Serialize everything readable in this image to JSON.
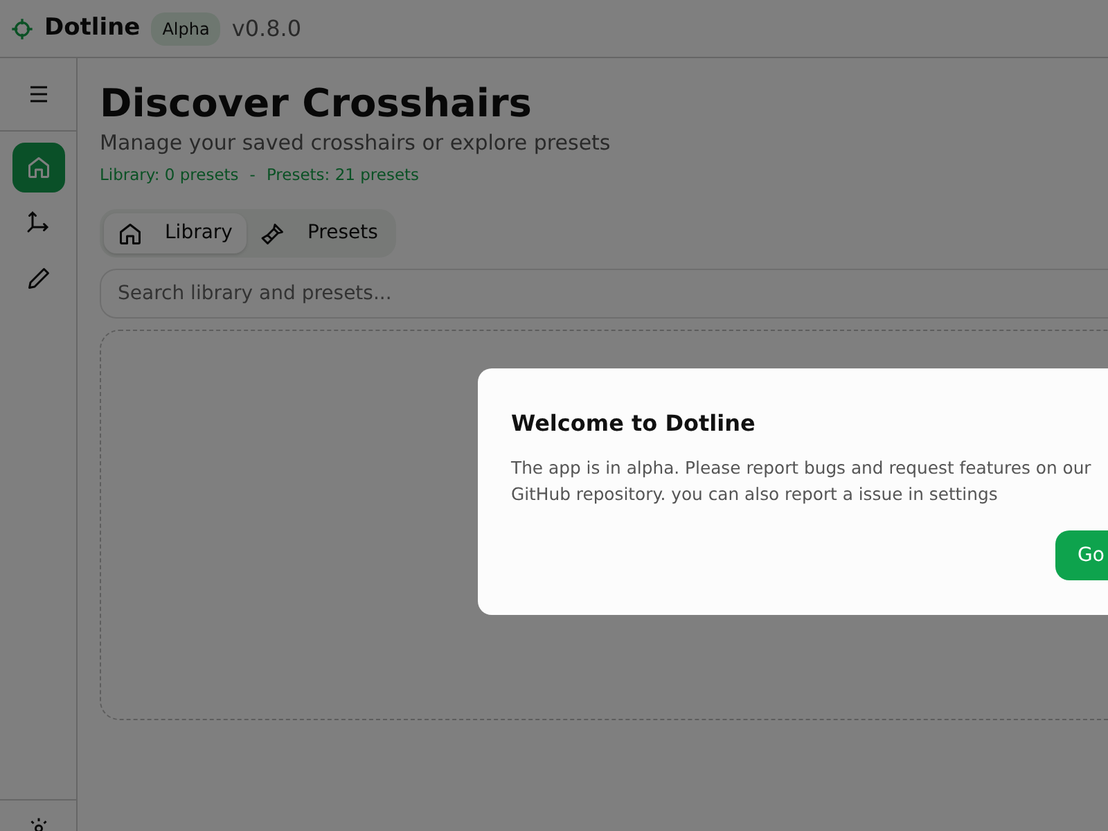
{
  "app": {
    "name": "Dotline",
    "badge": "Alpha",
    "version": "v0.8.0"
  },
  "sidebar": {
    "items": [
      {
        "kind": "home",
        "selected": true
      },
      {
        "kind": "axes",
        "selected": false
      },
      {
        "kind": "pencil",
        "selected": false
      }
    ]
  },
  "page": {
    "title": "Discover Crosshairs",
    "subtitle": "Manage your saved crosshairs or explore presets",
    "stats": [
      "Library: 0 presets",
      "-",
      "Presets: 21 presets"
    ]
  },
  "tabs": [
    {
      "label": "Library",
      "kind": "home",
      "selected": true
    },
    {
      "label": "Presets",
      "kind": "brush",
      "selected": false
    }
  ],
  "search": {
    "placeholder": "Search library and presets..."
  },
  "dialog": {
    "title": "Welcome to Dotline",
    "text": "The app is in alpha. Please report bugs and request features on our GitHub repository. you can also report a issue in settings",
    "button": "Go"
  }
}
